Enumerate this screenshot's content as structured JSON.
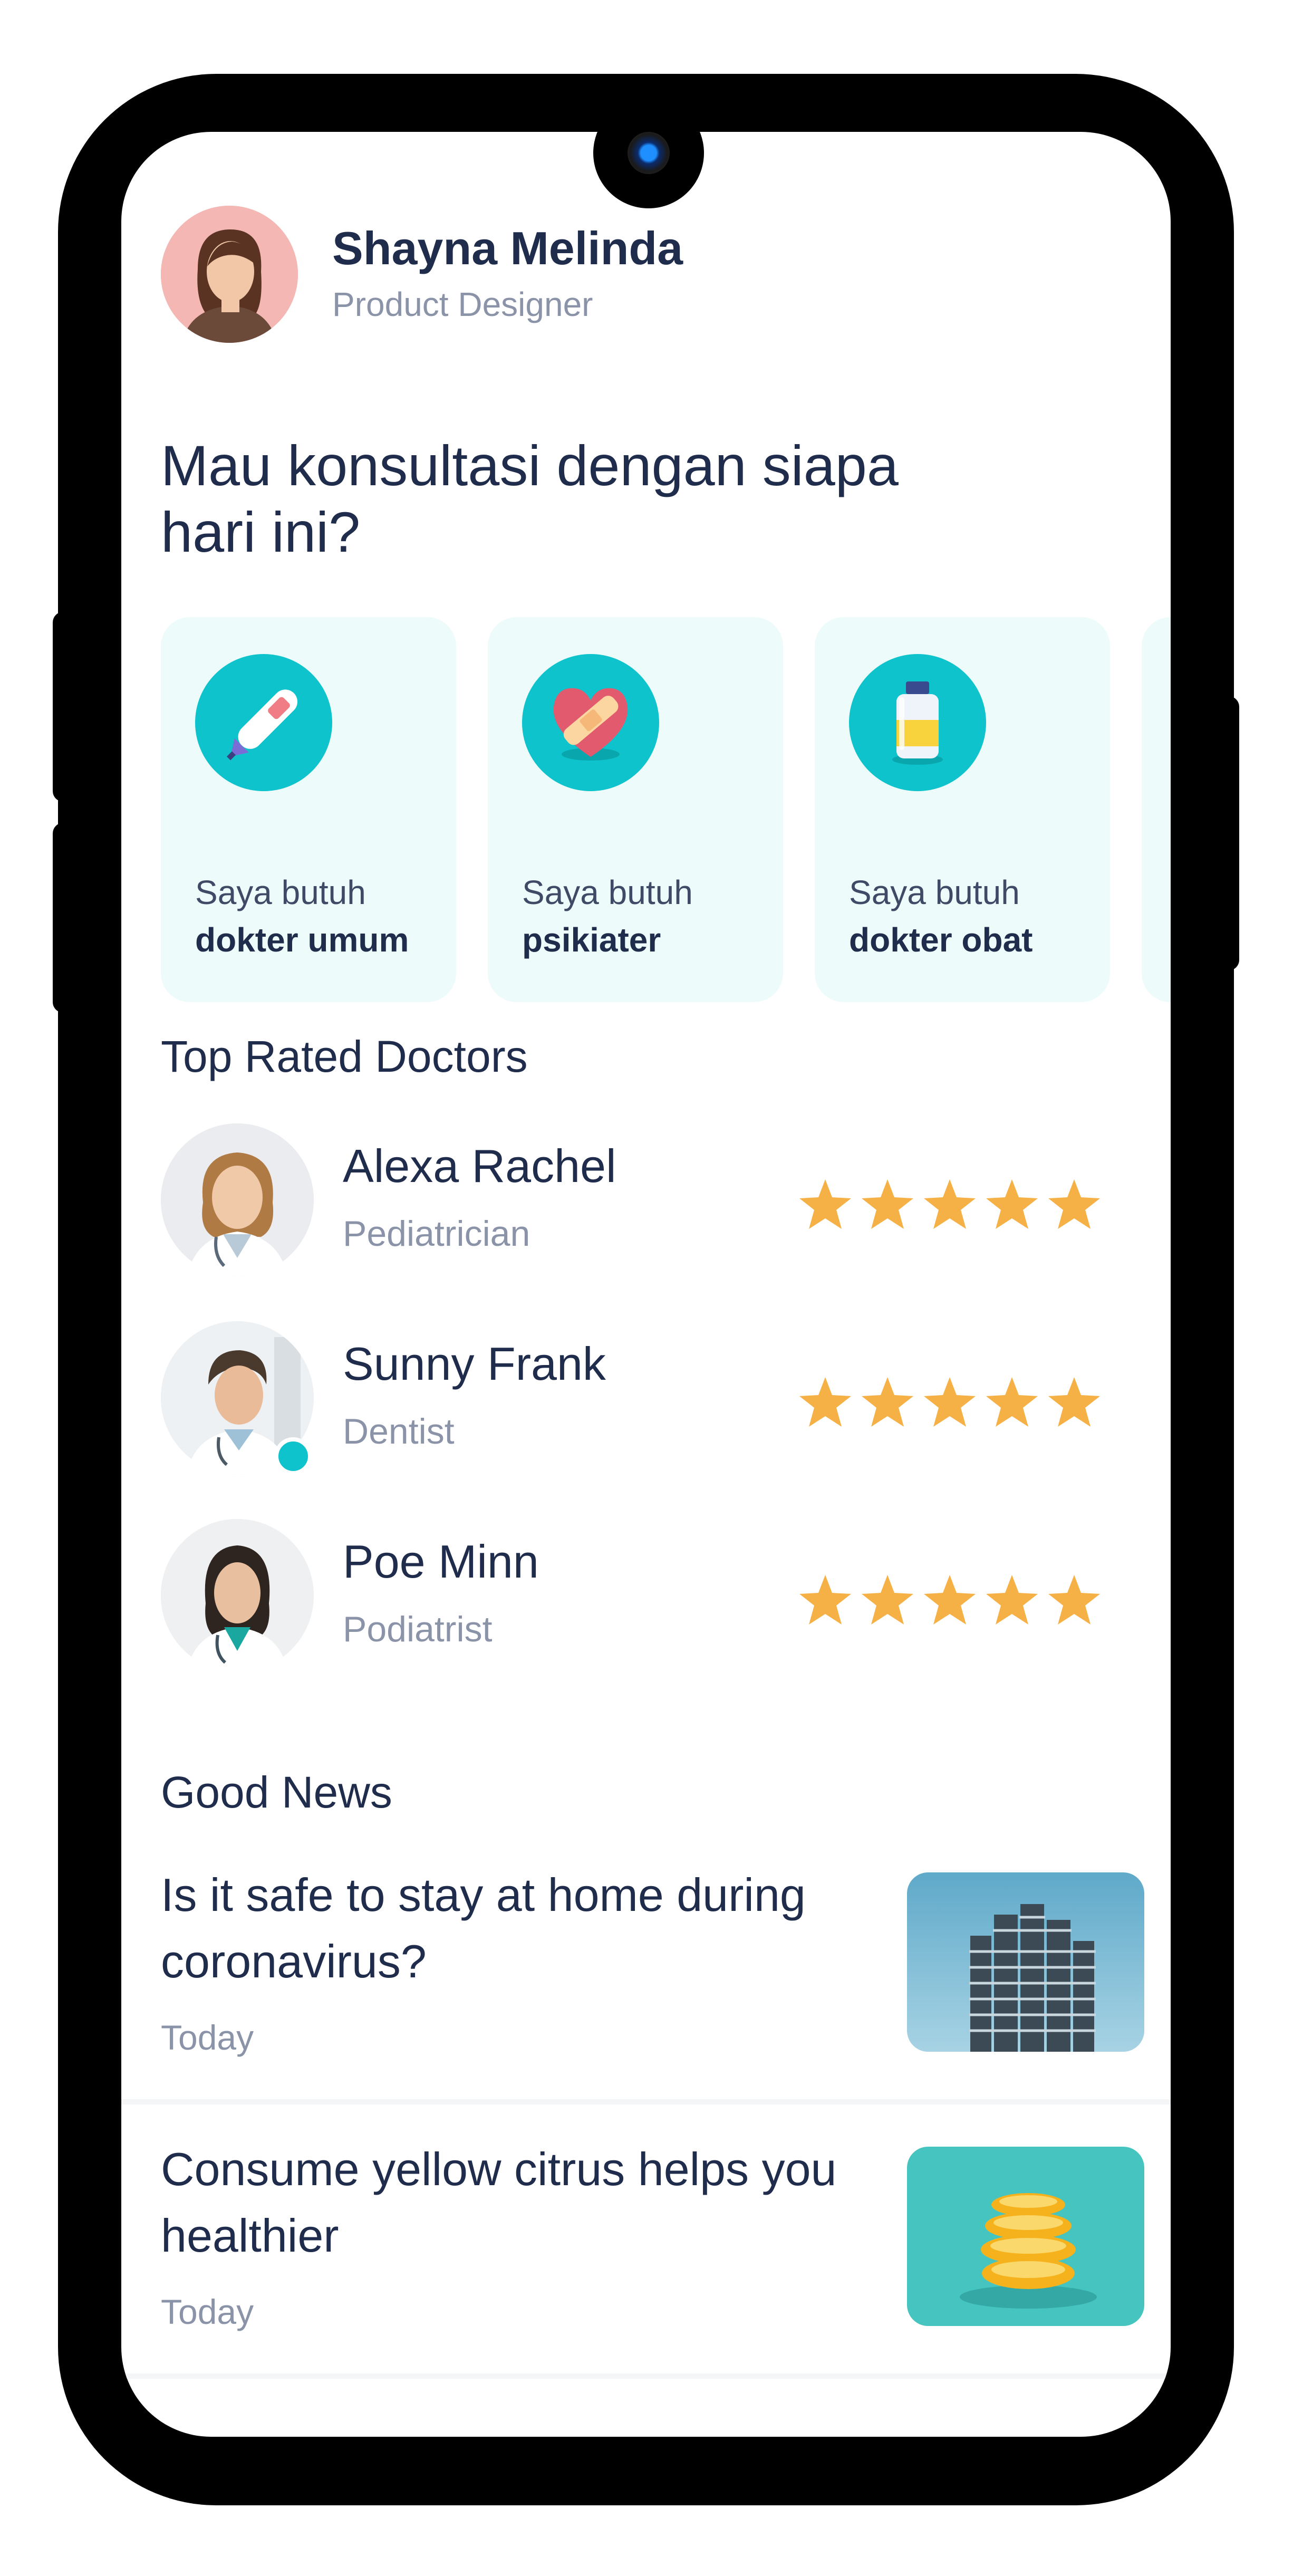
{
  "profile": {
    "name": "Shayna Melinda",
    "role": "Product Designer"
  },
  "headline": "Mau konsultasi dengan siapa hari ini?",
  "categories": [
    {
      "line1": "Saya butuh",
      "line2": "dokter umum",
      "icon": "thermometer-icon"
    },
    {
      "line1": "Saya butuh",
      "line2": "psikiater",
      "icon": "bandaged-heart-icon"
    },
    {
      "line1": "Saya butuh",
      "line2": "dokter obat",
      "icon": "medicine-bottle-icon"
    }
  ],
  "top_rated": {
    "title": "Top Rated Doctors",
    "doctors": [
      {
        "name": "Alexa Rachel",
        "specialty": "Pediatrician",
        "rating": 5,
        "online": false
      },
      {
        "name": "Sunny Frank",
        "specialty": "Dentist",
        "rating": 5,
        "online": true
      },
      {
        "name": "Poe Minn",
        "specialty": "Podiatrist",
        "rating": 5,
        "online": false
      }
    ]
  },
  "news": {
    "title": "Good News",
    "items": [
      {
        "title": "Is it safe to stay at home during coronavirus?",
        "date": "Today",
        "thumb": "building-photo"
      },
      {
        "title": "Consume yellow citrus helps you healthier",
        "date": "Today",
        "thumb": "citrus-photo"
      }
    ]
  },
  "colors": {
    "accent": "#0ec3cc",
    "card_bg": "#edfbfb",
    "star": "#f6b146",
    "text_dark": "#1f2c4c",
    "text_muted": "#8a93a8"
  }
}
